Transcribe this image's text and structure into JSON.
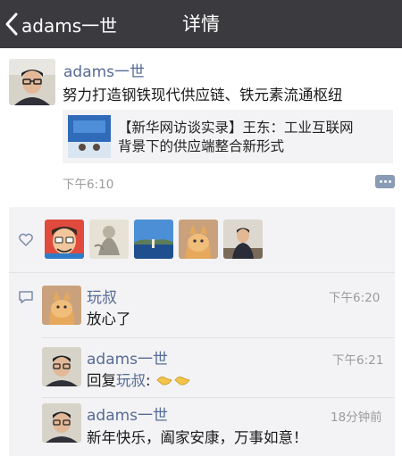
{
  "nav": {
    "back_label": "adams一世",
    "title": "详情"
  },
  "post": {
    "author": "adams一世",
    "text": "努力打造钢铁现代供应链、铁元素流通枢纽",
    "link_card": {
      "line1": "【新华网访谈实录】王东：工业互联网",
      "line2": "背景下的供应端整合新形式"
    },
    "time": "下午6:10"
  },
  "comments": [
    {
      "author": "玩叔",
      "time": "下午6:20",
      "text": "放心了"
    },
    {
      "author": "adams一世",
      "time": "下午6:21",
      "reply_prefix": "回复",
      "reply_to": "玩叔",
      "reply_suffix": ":"
    },
    {
      "author": "adams一世",
      "time": "18分钟前",
      "text": "新年快乐，阖家安康，万事如意！"
    }
  ],
  "colors": {
    "nav_bg": "#3a3a3f",
    "link_blue": "#576b95",
    "panel_bg": "#f3f3f5"
  }
}
